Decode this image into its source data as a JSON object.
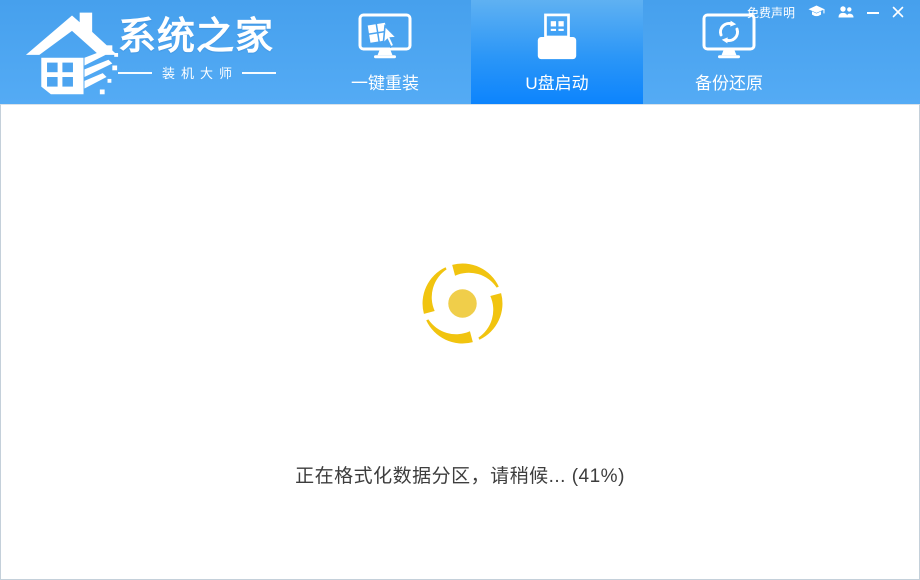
{
  "brand": {
    "name": "系统之家",
    "subtitle": "装机大师",
    "logo_icon": "pixel-house-logo"
  },
  "topbar": {
    "disclaimer": "免费声明",
    "icons": [
      "graduation-cap-icon",
      "users-icon",
      "minimize-icon",
      "close-icon"
    ]
  },
  "tabs": [
    {
      "label": "一键重装",
      "icon": "monitor-reinstall-icon",
      "active": false
    },
    {
      "label": "U盘启动",
      "icon": "usb-drive-icon",
      "active": true
    },
    {
      "label": "备份还原",
      "icon": "monitor-restore-icon",
      "active": false
    }
  ],
  "main": {
    "status_text": "正在格式化数据分区，请稍候... (41%)",
    "progress_percent": 41,
    "spinner_icon": "loading-spinner"
  },
  "colors": {
    "header_blue_top": "#46A0ED",
    "header_blue_bottom": "#54ABF5",
    "active_tab_top": "#5FB1F2",
    "active_tab_bottom": "#0C84FD",
    "spinner_ring_yellow": "#F1C40F",
    "spinner_center_yellow": "#F0CE4A",
    "status_text_gray": "#3D3D3D",
    "content_border": "#C4D0DA"
  }
}
